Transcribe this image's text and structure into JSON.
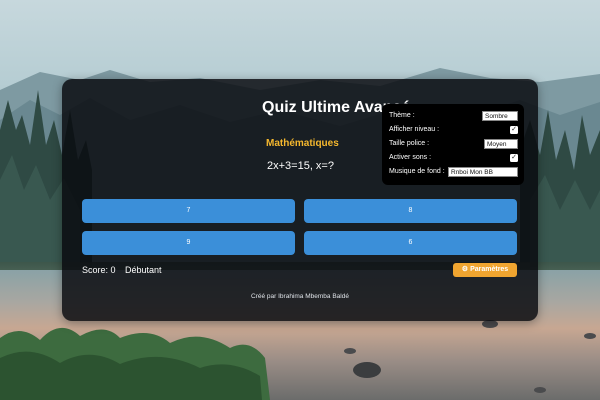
{
  "quiz": {
    "title": "Quiz Ultime Avancé",
    "category": "Mathématiques",
    "question": "2x+3=15, x=?",
    "answers": [
      "7",
      "8",
      "9",
      "6"
    ],
    "score_text": "Score: 0",
    "level_text": "Débutant",
    "settings_button_label": "Paramètres",
    "settings_button_icon": "gear-icon",
    "footer_text": "Créé par Ibrahima Mbemba Baldé"
  },
  "settings": {
    "theme_label": "Thème :",
    "theme_value": "Sombre",
    "show_level_label": "Afficher niveau :",
    "show_level_checked": true,
    "font_size_label": "Taille police :",
    "font_size_value": "Moyen",
    "sounds_label": "Activer sons :",
    "sounds_checked": true,
    "music_label": "Musique de fond :",
    "music_value": "Rnboi Mon BB"
  },
  "colors": {
    "accent_blue": "#3b8fd9",
    "category_yellow": "#f5b82e",
    "settings_button_orange": "#f0a530",
    "panel_bg": "#0a0c10"
  }
}
